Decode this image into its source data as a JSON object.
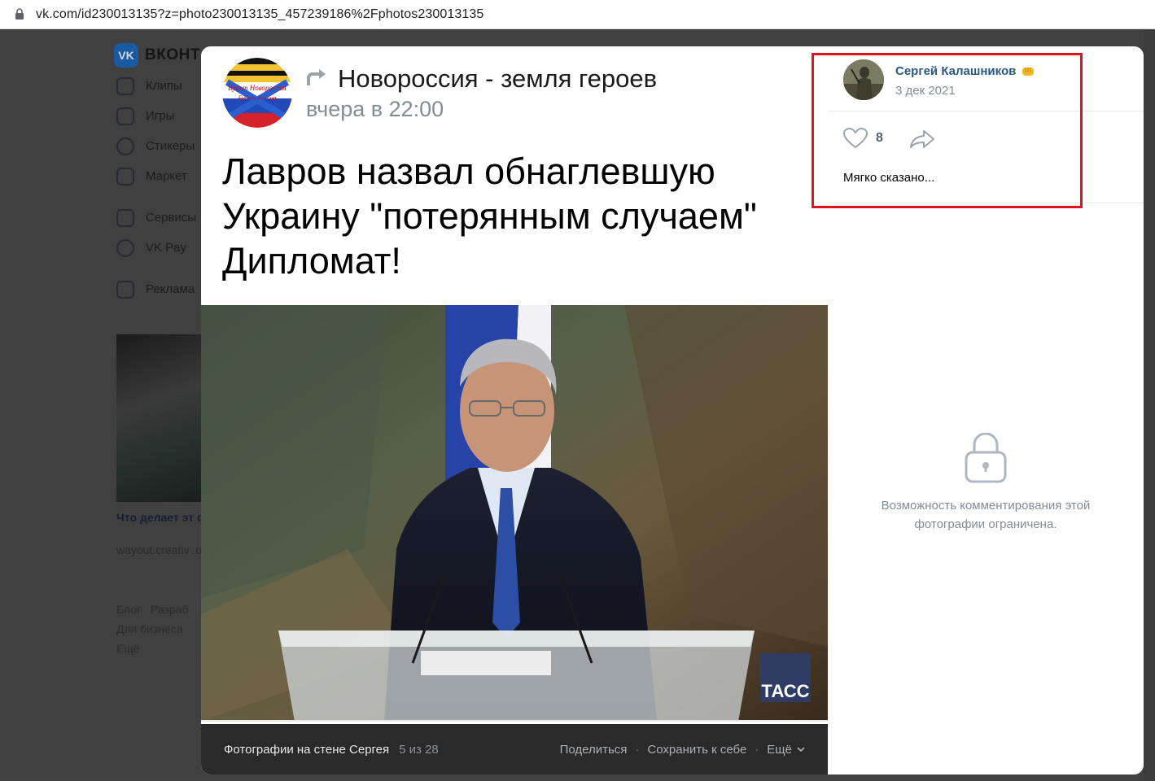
{
  "browser": {
    "url": "vk.com/id230013135?z=photo230013135_457239186%2Fphotos230013135"
  },
  "background_page": {
    "logo_text": "ВКОНТ",
    "menu_items": [
      "Клипы",
      "Игры",
      "Стикеры",
      "Маркет",
      "Сервисы",
      "VK Pay",
      "Реклама"
    ],
    "ad_title": "Что делает эт событие уник",
    "ad_source": "wayout.creativ .org",
    "footer_links": [
      "Блог",
      "Разраб",
      "Для бизнеса",
      "Ещё"
    ]
  },
  "post": {
    "group_name": "Новороссия - земля героев",
    "time": "вчера в 22:00",
    "headline": "Лавров назвал обнаглевшую Украину \"потерянным случаем\" Дипломат!",
    "avatar_text_top": "Будет Новороссия",
    "avatar_text_bottom": "Будет Россия",
    "photo_watermark": "ТАСС"
  },
  "photo_bar": {
    "album": "Фотографии на стене Сергея",
    "counter": "5 из 28",
    "share": "Поделиться",
    "save": "Сохранить к себе",
    "more": "Ещё"
  },
  "comment": {
    "author": "Сергей Калашников",
    "date": "3 дек 2021",
    "likes": "8",
    "text": "Мягко сказано..."
  },
  "comments_locked": {
    "message": "Возможность комментирования этой фотографии ограничена."
  },
  "colors": {
    "link_blue": "#2a5885",
    "muted_gray": "#818c99",
    "highlight_red": "#e1121c"
  }
}
